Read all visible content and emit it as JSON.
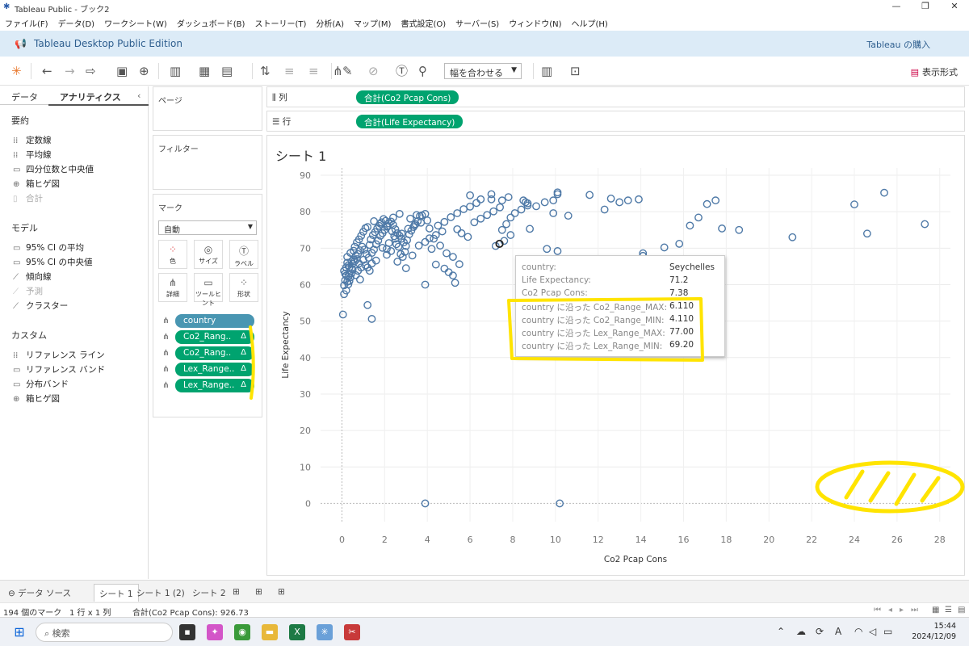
{
  "window": {
    "title": "Tableau Public - ブック2"
  },
  "menu": [
    "ファイル(F)",
    "データ(D)",
    "ワークシート(W)",
    "ダッシュボード(B)",
    "ストーリー(T)",
    "分析(A)",
    "マップ(M)",
    "書式設定(O)",
    "サーバー(S)",
    "ウィンドウ(N)",
    "ヘルプ(H)"
  ],
  "banner": {
    "edition": "Tableau Desktop Public Edition",
    "buy": "Tableau の購入"
  },
  "toolbar": {
    "fit": "幅を合わせる",
    "show_me": "表示形式"
  },
  "left_pane": {
    "tabs": [
      "データ",
      "アナリティクス"
    ],
    "sections": [
      {
        "title": "要約",
        "items": [
          {
            "label": "定数線",
            "icon": "constant-line-icon"
          },
          {
            "label": "平均線",
            "icon": "average-line-icon"
          },
          {
            "label": "四分位数と中央値",
            "icon": "quartile-icon"
          },
          {
            "label": "箱ヒゲ図",
            "icon": "box-plot-icon"
          },
          {
            "label": "合計",
            "icon": "totals-icon",
            "disabled": true
          }
        ]
      },
      {
        "title": "モデル",
        "items": [
          {
            "label": "95% CI の平均",
            "icon": "ci-mean-icon"
          },
          {
            "label": "95% CI の中央値",
            "icon": "ci-median-icon"
          },
          {
            "label": "傾向線",
            "icon": "trend-line-icon"
          },
          {
            "label": "予測",
            "icon": "forecast-icon",
            "disabled": true
          },
          {
            "label": "クラスター",
            "icon": "cluster-icon"
          }
        ]
      },
      {
        "title": "カスタム",
        "items": [
          {
            "label": "リファレンス ライン",
            "icon": "reference-line-icon"
          },
          {
            "label": "リファレンス バンド",
            "icon": "reference-band-icon"
          },
          {
            "label": "分布バンド",
            "icon": "distribution-band-icon"
          },
          {
            "label": "箱ヒゲ図",
            "icon": "box-plot-icon"
          }
        ]
      }
    ]
  },
  "pages_label": "ページ",
  "filters_label": "フィルター",
  "marks": {
    "label": "マーク",
    "type": "自動",
    "buttons": [
      {
        "label": "色",
        "icon": "color-icon"
      },
      {
        "label": "サイズ",
        "icon": "size-icon"
      },
      {
        "label": "ラベル",
        "icon": "label-icon"
      },
      {
        "label": "詳細",
        "icon": "detail-icon"
      },
      {
        "label": "ツールヒント",
        "icon": "tooltip-icon"
      },
      {
        "label": "形状",
        "icon": "shape-icon"
      }
    ],
    "fields": [
      {
        "label": "country",
        "color": "blue",
        "delta": ""
      },
      {
        "label": "Co2_Rang..",
        "color": "green",
        "delta": "Δ"
      },
      {
        "label": "Co2_Rang..",
        "color": "green",
        "delta": "Δ"
      },
      {
        "label": "Lex_Range..",
        "color": "green",
        "delta": "Δ"
      },
      {
        "label": "Lex_Range..",
        "color": "green",
        "delta": "Δ"
      }
    ]
  },
  "shelves": {
    "columns_label": "列",
    "columns_pill": "合計(Co2 Pcap Cons)",
    "rows_label": "行",
    "rows_pill": "合計(Life Expectancy)"
  },
  "sheet_title": "シート 1",
  "chart_data": {
    "type": "scatter",
    "xlabel": "Co2 Pcap Cons",
    "ylabel": "Life Expectancy",
    "xlim": [
      -1,
      28.5
    ],
    "ylim": [
      -5,
      92
    ],
    "xticks": [
      0,
      2,
      4,
      6,
      8,
      10,
      12,
      14,
      16,
      18,
      20,
      22,
      24,
      26,
      28
    ],
    "yticks": [
      0,
      10,
      20,
      30,
      40,
      50,
      60,
      70,
      80,
      90
    ],
    "highlight": {
      "x": 7.38,
      "y": 71.2
    },
    "points": [
      [
        0.05,
        51.8
      ],
      [
        0.1,
        57.4
      ],
      [
        0.1,
        59.8
      ],
      [
        0.15,
        61.2
      ],
      [
        0.2,
        62.5
      ],
      [
        0.1,
        63.8
      ],
      [
        0.2,
        64.7
      ],
      [
        0.25,
        66.0
      ],
      [
        0.3,
        60.1
      ],
      [
        0.35,
        61.0
      ],
      [
        0.4,
        62.0
      ],
      [
        0.45,
        63.1
      ],
      [
        0.5,
        64.1
      ],
      [
        0.3,
        65.3
      ],
      [
        0.25,
        67.6
      ],
      [
        0.4,
        68.7
      ],
      [
        0.55,
        69.3
      ],
      [
        0.6,
        66.4
      ],
      [
        0.7,
        67.0
      ],
      [
        0.8,
        65.8
      ],
      [
        0.9,
        64.7
      ],
      [
        1.0,
        66.8
      ],
      [
        1.1,
        65.3
      ],
      [
        1.2,
        64.7
      ],
      [
        1.3,
        63.8
      ],
      [
        0.6,
        70.4
      ],
      [
        0.7,
        71.6
      ],
      [
        0.8,
        72.4
      ],
      [
        0.9,
        73.4
      ],
      [
        1.0,
        74.5
      ],
      [
        1.1,
        75.5
      ],
      [
        1.2,
        75.8
      ],
      [
        1.3,
        70.9
      ],
      [
        1.4,
        68.7
      ],
      [
        1.5,
        69.6
      ],
      [
        1.6,
        71.1
      ],
      [
        1.7,
        72.1
      ],
      [
        1.8,
        73.4
      ],
      [
        1.9,
        74.1
      ],
      [
        2.0,
        75.0
      ],
      [
        2.1,
        75.9
      ],
      [
        2.2,
        76.8
      ],
      [
        2.3,
        77.3
      ],
      [
        2.4,
        76.4
      ],
      [
        2.5,
        75.2
      ],
      [
        2.6,
        74.1
      ],
      [
        2.7,
        73.4
      ],
      [
        2.8,
        72.6
      ],
      [
        2.9,
        71.6
      ],
      [
        3.0,
        70.6
      ],
      [
        2.3,
        69.2
      ],
      [
        2.1,
        68.2
      ],
      [
        1.6,
        66.6
      ],
      [
        1.4,
        65.8
      ],
      [
        1.9,
        70.1
      ],
      [
        2.2,
        71.4
      ],
      [
        2.5,
        72.6
      ],
      [
        2.8,
        74.0
      ],
      [
        3.1,
        75.3
      ],
      [
        3.4,
        76.3
      ],
      [
        3.7,
        77.0
      ],
      [
        4.0,
        77.6
      ],
      [
        3.2,
        78.1
      ],
      [
        3.5,
        79.1
      ],
      [
        2.7,
        79.4
      ],
      [
        2.4,
        78.4
      ],
      [
        1.8,
        76.7
      ],
      [
        1.5,
        77.4
      ],
      [
        3.3,
        68.0
      ],
      [
        3.6,
        70.7
      ],
      [
        3.9,
        71.7
      ],
      [
        4.1,
        72.7
      ],
      [
        4.4,
        73.6
      ],
      [
        4.7,
        74.6
      ],
      [
        4.2,
        69.8
      ],
      [
        4.5,
        76.2
      ],
      [
        4.8,
        77.2
      ],
      [
        5.1,
        78.5
      ],
      [
        5.4,
        79.6
      ],
      [
        5.7,
        80.7
      ],
      [
        6.0,
        81.4
      ],
      [
        6.3,
        82.4
      ],
      [
        5.4,
        75.2
      ],
      [
        5.6,
        74.1
      ],
      [
        5.9,
        73.1
      ],
      [
        6.2,
        77.1
      ],
      [
        6.5,
        78.1
      ],
      [
        6.8,
        79.1
      ],
      [
        7.1,
        80.1
      ],
      [
        7.4,
        81.2
      ],
      [
        3.9,
        79.4
      ],
      [
        4.1,
        75.4
      ],
      [
        4.3,
        72.6
      ],
      [
        4.6,
        70.7
      ],
      [
        4.9,
        68.6
      ],
      [
        5.2,
        67.6
      ],
      [
        5.5,
        65.6
      ],
      [
        5.2,
        62.5
      ],
      [
        5.3,
        60.5
      ],
      [
        5.0,
        63.4
      ],
      [
        4.8,
        64.4
      ],
      [
        4.4,
        65.5
      ],
      [
        3.0,
        64.5
      ],
      [
        2.1,
        69.8
      ],
      [
        2.6,
        66.3
      ],
      [
        1.2,
        54.4
      ],
      [
        1.4,
        50.6
      ],
      [
        3.9,
        60.0
      ],
      [
        7.2,
        70.6
      ],
      [
        7.6,
        72.0
      ],
      [
        7.9,
        73.6
      ],
      [
        7.5,
        75.0
      ],
      [
        7.7,
        76.6
      ],
      [
        7.9,
        78.4
      ],
      [
        8.1,
        79.6
      ],
      [
        8.4,
        80.6
      ],
      [
        8.7,
        81.7
      ],
      [
        8.5,
        83.1
      ],
      [
        8.7,
        82.3
      ],
      [
        6.5,
        83.4
      ],
      [
        7.0,
        83.4
      ],
      [
        7.5,
        83.1
      ],
      [
        6.0,
        84.5
      ],
      [
        7.0,
        84.8
      ],
      [
        7.8,
        84.0
      ],
      [
        8.6,
        82.6
      ],
      [
        9.1,
        81.5
      ],
      [
        9.5,
        82.6
      ],
      [
        9.9,
        83.1
      ],
      [
        10.1,
        84.8
      ],
      [
        10.1,
        85.3
      ],
      [
        9.9,
        79.6
      ],
      [
        10.6,
        78.9
      ],
      [
        9.6,
        69.8
      ],
      [
        10.1,
        69.2
      ],
      [
        8.8,
        75.3
      ],
      [
        11.6,
        84.6
      ],
      [
        12.3,
        80.6
      ],
      [
        12.6,
        83.6
      ],
      [
        13.0,
        82.6
      ],
      [
        13.4,
        83.1
      ],
      [
        13.9,
        83.4
      ],
      [
        14.1,
        68.6
      ],
      [
        14.1,
        67.9
      ],
      [
        15.1,
        70.2
      ],
      [
        15.8,
        71.2
      ],
      [
        16.3,
        76.2
      ],
      [
        16.7,
        78.4
      ],
      [
        17.1,
        82.1
      ],
      [
        17.5,
        83.1
      ],
      [
        17.8,
        75.4
      ],
      [
        18.6,
        75.0
      ],
      [
        21.1,
        73.0
      ],
      [
        24.0,
        82.0
      ],
      [
        24.6,
        74.0
      ],
      [
        25.4,
        85.2
      ],
      [
        27.3,
        76.6
      ],
      [
        7.38,
        71.2
      ],
      [
        3.9,
        0
      ],
      [
        10.2,
        0
      ],
      [
        0.2,
        58.4
      ],
      [
        0.25,
        60.8
      ],
      [
        0.3,
        62.2
      ],
      [
        0.35,
        63.1
      ],
      [
        0.45,
        64.4
      ],
      [
        0.5,
        65.7
      ],
      [
        0.55,
        66.9
      ],
      [
        0.65,
        67.9
      ],
      [
        0.75,
        68.4
      ],
      [
        0.85,
        69.4
      ],
      [
        0.95,
        70.4
      ],
      [
        1.05,
        69.6
      ],
      [
        1.15,
        68.4
      ],
      [
        1.25,
        67.4
      ],
      [
        1.35,
        72.4
      ],
      [
        1.45,
        73.6
      ],
      [
        1.55,
        74.4
      ],
      [
        1.65,
        75.4
      ],
      [
        1.75,
        76.1
      ],
      [
        1.85,
        77.1
      ],
      [
        1.95,
        78.0
      ],
      [
        2.05,
        77.5
      ],
      [
        2.15,
        76.1
      ],
      [
        2.35,
        74.6
      ],
      [
        2.45,
        73.3
      ],
      [
        2.55,
        71.1
      ],
      [
        2.65,
        70.4
      ],
      [
        2.75,
        68.4
      ],
      [
        2.85,
        67.6
      ],
      [
        2.95,
        69.0
      ],
      [
        3.05,
        72.2
      ],
      [
        3.15,
        73.8
      ],
      [
        3.25,
        74.8
      ],
      [
        3.35,
        75.8
      ],
      [
        3.45,
        76.6
      ],
      [
        3.55,
        77.4
      ],
      [
        3.65,
        78.8
      ],
      [
        3.75,
        79.0
      ],
      [
        0.15,
        63.0
      ],
      [
        0.35,
        64.8
      ],
      [
        0.45,
        66.4
      ],
      [
        0.65,
        62.6
      ],
      [
        0.75,
        63.8
      ],
      [
        0.85,
        61.4
      ]
    ]
  },
  "tooltip": {
    "rows": [
      {
        "k": "country:",
        "v": "Seychelles"
      },
      {
        "k": "Life Expectancy:",
        "v": "71.2"
      },
      {
        "k": "Co2 Pcap Cons:",
        "v": "7.38"
      },
      {
        "k": "country に沿った Co2_Range_MAX:",
        "v": "6.110"
      },
      {
        "k": "country に沿った Co2_Range_MIN:",
        "v": "4.110"
      },
      {
        "k": "country に沿った Lex_Range_MAX:",
        "v": "77.00"
      },
      {
        "k": "country に沿った Lex_Range_MIN:",
        "v": "69.20"
      }
    ]
  },
  "tabs": {
    "datasource": "データ ソース",
    "sheets": [
      "シート 1",
      "シート 1 (2)",
      "シート 2"
    ]
  },
  "status": {
    "marks": "194 個のマーク",
    "dims": "1 行 x 1 列",
    "sum": "合計(Co2 Pcap Cons): 926.73"
  },
  "taskbar": {
    "search": "検索",
    "time": "15:44",
    "date": "2024/12/09"
  },
  "colors": {
    "accent": "#00a36f",
    "dim_pill": "#4996b2",
    "mark": "#4e79a7",
    "annotation": "#ffe400"
  }
}
